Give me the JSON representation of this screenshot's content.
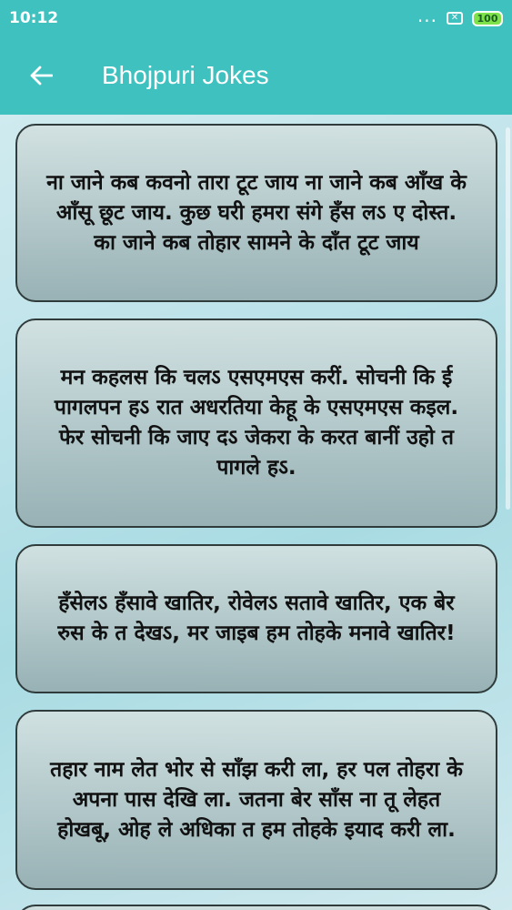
{
  "status_bar": {
    "time": "10:12",
    "dots": "...",
    "battery": "100"
  },
  "app_bar": {
    "title": "Bhojpuri Jokes",
    "back_icon": "arrow-left-icon"
  },
  "jokes": [
    "ना जाने कब कवनो तारा टूट जाय ना जाने कब आँख के आँसू छूट जाय. कुछ घरी हमरा संगे हँस लऽ ए दोस्त. का जाने कब तोहार सामने के दाँत टूट जाय",
    "मन कहलस कि चलऽ एसएमएस करीं. सोचनी कि ई पागलपन हऽ रात अधरतिया केहू के एसएमएस कइल. फेर सोचनी कि जाए दऽ जेकरा के करत बानीं उहो त पागले हऽ.",
    "हँसेलऽ हँसावे खातिर, रोवेलऽ सतावे खातिर, एक बेर रुस के त देखऽ, मर जाइब हम तोहके मनावे खातिर!",
    "तहार नाम लेत भोर से साँझ करी ला, हर पल तोहरा के अपना पास देखि ला. जतना बेर साँस ना तू लेहत होखबू, ओह ले अधिका त हम तोहके इयाद करी ला."
  ],
  "colors": {
    "app_bar": "#3fc1c0",
    "card_border": "#2f3c3b"
  }
}
